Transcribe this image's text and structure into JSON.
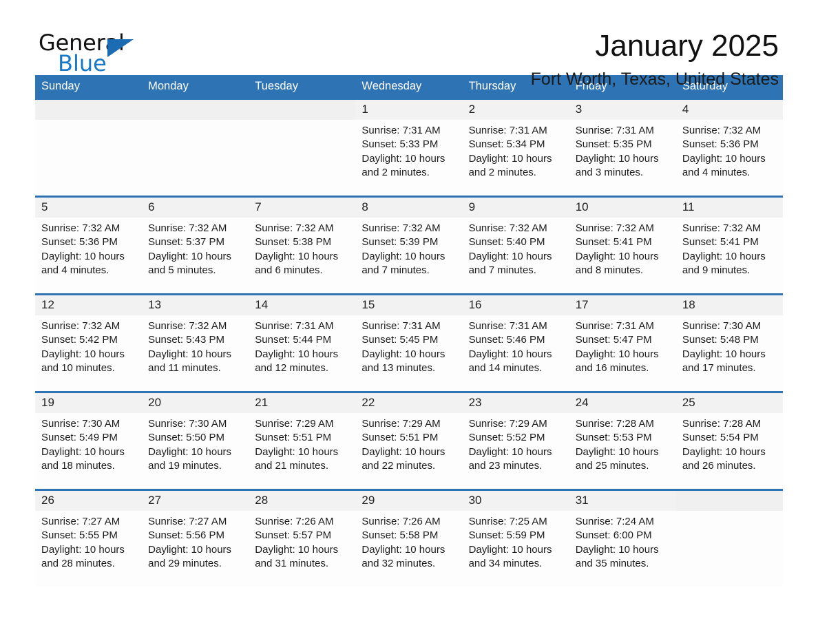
{
  "brand": {
    "name_part1": "General",
    "name_part2": "Blue",
    "flag_icon": "triangle-flag-icon"
  },
  "header": {
    "month_title": "January 2025",
    "location": "Fort Worth, Texas, United States"
  },
  "colors": {
    "header_blue": "#2e74b5",
    "brand_blue": "#1878c8",
    "daynum_bg": "#f2f2f2",
    "cell_bg": "#fdfdfd"
  },
  "calendar": {
    "weekday_headers": [
      "Sunday",
      "Monday",
      "Tuesday",
      "Wednesday",
      "Thursday",
      "Friday",
      "Saturday"
    ],
    "weeks": [
      [
        {
          "day": "",
          "lines": []
        },
        {
          "day": "",
          "lines": []
        },
        {
          "day": "",
          "lines": []
        },
        {
          "day": "1",
          "lines": [
            "Sunrise: 7:31 AM",
            "Sunset: 5:33 PM",
            "Daylight: 10 hours",
            "and 2 minutes."
          ]
        },
        {
          "day": "2",
          "lines": [
            "Sunrise: 7:31 AM",
            "Sunset: 5:34 PM",
            "Daylight: 10 hours",
            "and 2 minutes."
          ]
        },
        {
          "day": "3",
          "lines": [
            "Sunrise: 7:31 AM",
            "Sunset: 5:35 PM",
            "Daylight: 10 hours",
            "and 3 minutes."
          ]
        },
        {
          "day": "4",
          "lines": [
            "Sunrise: 7:32 AM",
            "Sunset: 5:36 PM",
            "Daylight: 10 hours",
            "and 4 minutes."
          ]
        }
      ],
      [
        {
          "day": "5",
          "lines": [
            "Sunrise: 7:32 AM",
            "Sunset: 5:36 PM",
            "Daylight: 10 hours",
            "and 4 minutes."
          ]
        },
        {
          "day": "6",
          "lines": [
            "Sunrise: 7:32 AM",
            "Sunset: 5:37 PM",
            "Daylight: 10 hours",
            "and 5 minutes."
          ]
        },
        {
          "day": "7",
          "lines": [
            "Sunrise: 7:32 AM",
            "Sunset: 5:38 PM",
            "Daylight: 10 hours",
            "and 6 minutes."
          ]
        },
        {
          "day": "8",
          "lines": [
            "Sunrise: 7:32 AM",
            "Sunset: 5:39 PM",
            "Daylight: 10 hours",
            "and 7 minutes."
          ]
        },
        {
          "day": "9",
          "lines": [
            "Sunrise: 7:32 AM",
            "Sunset: 5:40 PM",
            "Daylight: 10 hours",
            "and 7 minutes."
          ]
        },
        {
          "day": "10",
          "lines": [
            "Sunrise: 7:32 AM",
            "Sunset: 5:41 PM",
            "Daylight: 10 hours",
            "and 8 minutes."
          ]
        },
        {
          "day": "11",
          "lines": [
            "Sunrise: 7:32 AM",
            "Sunset: 5:41 PM",
            "Daylight: 10 hours",
            "and 9 minutes."
          ]
        }
      ],
      [
        {
          "day": "12",
          "lines": [
            "Sunrise: 7:32 AM",
            "Sunset: 5:42 PM",
            "Daylight: 10 hours",
            "and 10 minutes."
          ]
        },
        {
          "day": "13",
          "lines": [
            "Sunrise: 7:32 AM",
            "Sunset: 5:43 PM",
            "Daylight: 10 hours",
            "and 11 minutes."
          ]
        },
        {
          "day": "14",
          "lines": [
            "Sunrise: 7:31 AM",
            "Sunset: 5:44 PM",
            "Daylight: 10 hours",
            "and 12 minutes."
          ]
        },
        {
          "day": "15",
          "lines": [
            "Sunrise: 7:31 AM",
            "Sunset: 5:45 PM",
            "Daylight: 10 hours",
            "and 13 minutes."
          ]
        },
        {
          "day": "16",
          "lines": [
            "Sunrise: 7:31 AM",
            "Sunset: 5:46 PM",
            "Daylight: 10 hours",
            "and 14 minutes."
          ]
        },
        {
          "day": "17",
          "lines": [
            "Sunrise: 7:31 AM",
            "Sunset: 5:47 PM",
            "Daylight: 10 hours",
            "and 16 minutes."
          ]
        },
        {
          "day": "18",
          "lines": [
            "Sunrise: 7:30 AM",
            "Sunset: 5:48 PM",
            "Daylight: 10 hours",
            "and 17 minutes."
          ]
        }
      ],
      [
        {
          "day": "19",
          "lines": [
            "Sunrise: 7:30 AM",
            "Sunset: 5:49 PM",
            "Daylight: 10 hours",
            "and 18 minutes."
          ]
        },
        {
          "day": "20",
          "lines": [
            "Sunrise: 7:30 AM",
            "Sunset: 5:50 PM",
            "Daylight: 10 hours",
            "and 19 minutes."
          ]
        },
        {
          "day": "21",
          "lines": [
            "Sunrise: 7:29 AM",
            "Sunset: 5:51 PM",
            "Daylight: 10 hours",
            "and 21 minutes."
          ]
        },
        {
          "day": "22",
          "lines": [
            "Sunrise: 7:29 AM",
            "Sunset: 5:51 PM",
            "Daylight: 10 hours",
            "and 22 minutes."
          ]
        },
        {
          "day": "23",
          "lines": [
            "Sunrise: 7:29 AM",
            "Sunset: 5:52 PM",
            "Daylight: 10 hours",
            "and 23 minutes."
          ]
        },
        {
          "day": "24",
          "lines": [
            "Sunrise: 7:28 AM",
            "Sunset: 5:53 PM",
            "Daylight: 10 hours",
            "and 25 minutes."
          ]
        },
        {
          "day": "25",
          "lines": [
            "Sunrise: 7:28 AM",
            "Sunset: 5:54 PM",
            "Daylight: 10 hours",
            "and 26 minutes."
          ]
        }
      ],
      [
        {
          "day": "26",
          "lines": [
            "Sunrise: 7:27 AM",
            "Sunset: 5:55 PM",
            "Daylight: 10 hours",
            "and 28 minutes."
          ]
        },
        {
          "day": "27",
          "lines": [
            "Sunrise: 7:27 AM",
            "Sunset: 5:56 PM",
            "Daylight: 10 hours",
            "and 29 minutes."
          ]
        },
        {
          "day": "28",
          "lines": [
            "Sunrise: 7:26 AM",
            "Sunset: 5:57 PM",
            "Daylight: 10 hours",
            "and 31 minutes."
          ]
        },
        {
          "day": "29",
          "lines": [
            "Sunrise: 7:26 AM",
            "Sunset: 5:58 PM",
            "Daylight: 10 hours",
            "and 32 minutes."
          ]
        },
        {
          "day": "30",
          "lines": [
            "Sunrise: 7:25 AM",
            "Sunset: 5:59 PM",
            "Daylight: 10 hours",
            "and 34 minutes."
          ]
        },
        {
          "day": "31",
          "lines": [
            "Sunrise: 7:24 AM",
            "Sunset: 6:00 PM",
            "Daylight: 10 hours",
            "and 35 minutes."
          ]
        },
        {
          "day": "",
          "lines": []
        }
      ]
    ]
  }
}
